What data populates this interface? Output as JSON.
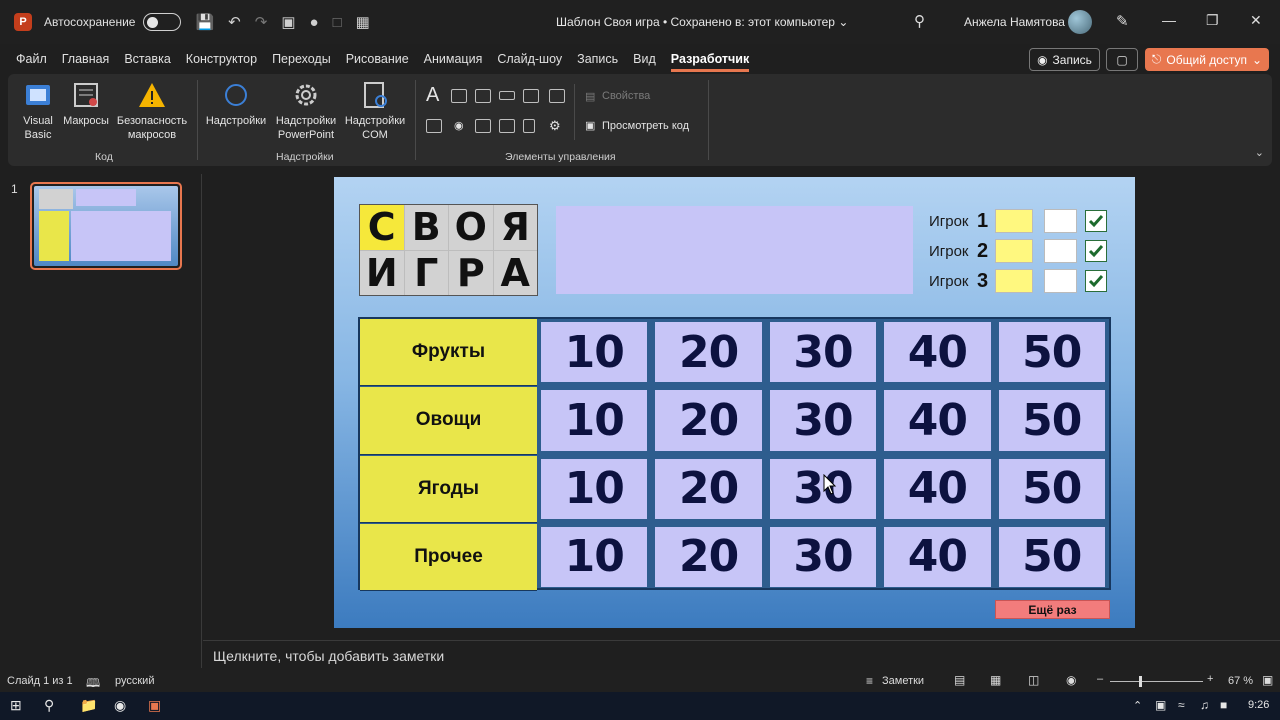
{
  "titlebar": {
    "app_logo": "P",
    "autosave_label": "Автосохранение",
    "doc_title": "Шаблон Своя игра • Сохранено в: этот компьютер ⌄",
    "user_name": "Анжела Намятова",
    "icons": [
      "save-icon",
      "undo-icon",
      "redo-icon",
      "search-icon",
      "pen-icon",
      "minimize-icon",
      "restore-icon",
      "close-icon"
    ]
  },
  "tabs": [
    "Файл",
    "Главная",
    "Вставка",
    "Конструктор",
    "Переходы",
    "Рисование",
    "Анимация",
    "Слайд-шоу",
    "Запись",
    "Вид",
    "Разработчик"
  ],
  "active_tab": "Разработчик",
  "top_buttons": {
    "record": "Запись",
    "share": "Общий доступ"
  },
  "ribbon": {
    "visual_basic": "Visual\nBasic",
    "vb_line1": "Visual",
    "vb_line2": "Basic",
    "macros": "Макросы",
    "security_line1": "Безопасность",
    "security_line2": "макросов",
    "group_code": "Код",
    "addins": "Надстройки",
    "pp_addins_line1": "Надстройки",
    "pp_addins_line2": "PowerPoint",
    "com_addins_line1": "Надстройки",
    "com_addins_line2": "COM",
    "group_addins": "Надстройки",
    "properties": "Свойства",
    "view_code": "Просмотреть код",
    "group_controls": "Элементы управления"
  },
  "thumbnails": {
    "slide_number": "1"
  },
  "slide": {
    "logo_letters_top": [
      "С",
      "В",
      "О",
      "Я"
    ],
    "logo_letters_bottom": [
      "И",
      "Г",
      "Р",
      "А"
    ],
    "players": [
      {
        "label": "Игрок",
        "number": "1"
      },
      {
        "label": "Игрок",
        "number": "2"
      },
      {
        "label": "Игрок",
        "number": "3"
      }
    ],
    "categories": [
      "Фрукты",
      "Овощи",
      "Ягоды",
      "Прочее"
    ],
    "points": [
      "10",
      "20",
      "30",
      "40",
      "50"
    ],
    "again_button": "Ещё раз"
  },
  "notes_placeholder": "Щелкните, чтобы добавить заметки",
  "statusbar": {
    "slide_info": "Слайд 1 из 1",
    "language": "русский",
    "notes_label": "Заметки",
    "zoom": "67 %",
    "zoom_level": 0.67
  },
  "taskbar": {
    "time": "9:26"
  },
  "colors": {
    "accent": "#e8774f",
    "category_yellow": "#e9e64a",
    "cell_lavender": "#c7c5f7",
    "again_red": "#f27c7c"
  }
}
